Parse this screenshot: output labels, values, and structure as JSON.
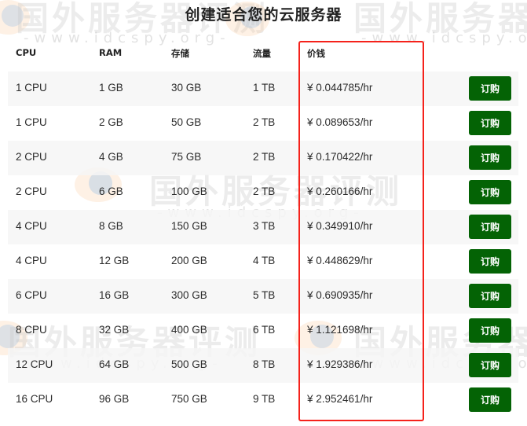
{
  "page": {
    "title": "创建适合您的云服务器"
  },
  "watermark": {
    "text": "国外服务器评测",
    "url": "-www.idcspy.org-"
  },
  "table": {
    "headers": {
      "cpu": "CPU",
      "ram": "RAM",
      "storage": "存储",
      "traffic": "流量",
      "price": "价钱"
    },
    "buy_label": "订购",
    "button_color": "#046305",
    "highlight_color": "#f5221b",
    "rows": [
      {
        "cpu": "1 CPU",
        "ram": "1 GB",
        "storage": "30 GB",
        "traffic": "1 TB",
        "price": "¥ 0.044785/hr"
      },
      {
        "cpu": "1 CPU",
        "ram": "2 GB",
        "storage": "50 GB",
        "traffic": "2 TB",
        "price": "¥ 0.089653/hr"
      },
      {
        "cpu": "2 CPU",
        "ram": "4 GB",
        "storage": "75 GB",
        "traffic": "2 TB",
        "price": "¥ 0.170422/hr"
      },
      {
        "cpu": "2 CPU",
        "ram": "6 GB",
        "storage": "100 GB",
        "traffic": "2 TB",
        "price": "¥ 0.260166/hr"
      },
      {
        "cpu": "4 CPU",
        "ram": "8 GB",
        "storage": "150 GB",
        "traffic": "3 TB",
        "price": "¥ 0.349910/hr"
      },
      {
        "cpu": "4 CPU",
        "ram": "12 GB",
        "storage": "200 GB",
        "traffic": "4 TB",
        "price": "¥ 0.448629/hr"
      },
      {
        "cpu": "6 CPU",
        "ram": "16 GB",
        "storage": "300 GB",
        "traffic": "5 TB",
        "price": "¥ 0.690935/hr"
      },
      {
        "cpu": "8 CPU",
        "ram": "32 GB",
        "storage": "400 GB",
        "traffic": "6 TB",
        "price": "¥ 1.121698/hr"
      },
      {
        "cpu": "12 CPU",
        "ram": "64 GB",
        "storage": "500 GB",
        "traffic": "8 TB",
        "price": "¥ 1.929386/hr"
      },
      {
        "cpu": "16 CPU",
        "ram": "96 GB",
        "storage": "750 GB",
        "traffic": "9 TB",
        "price": "¥ 2.952461/hr"
      }
    ]
  }
}
